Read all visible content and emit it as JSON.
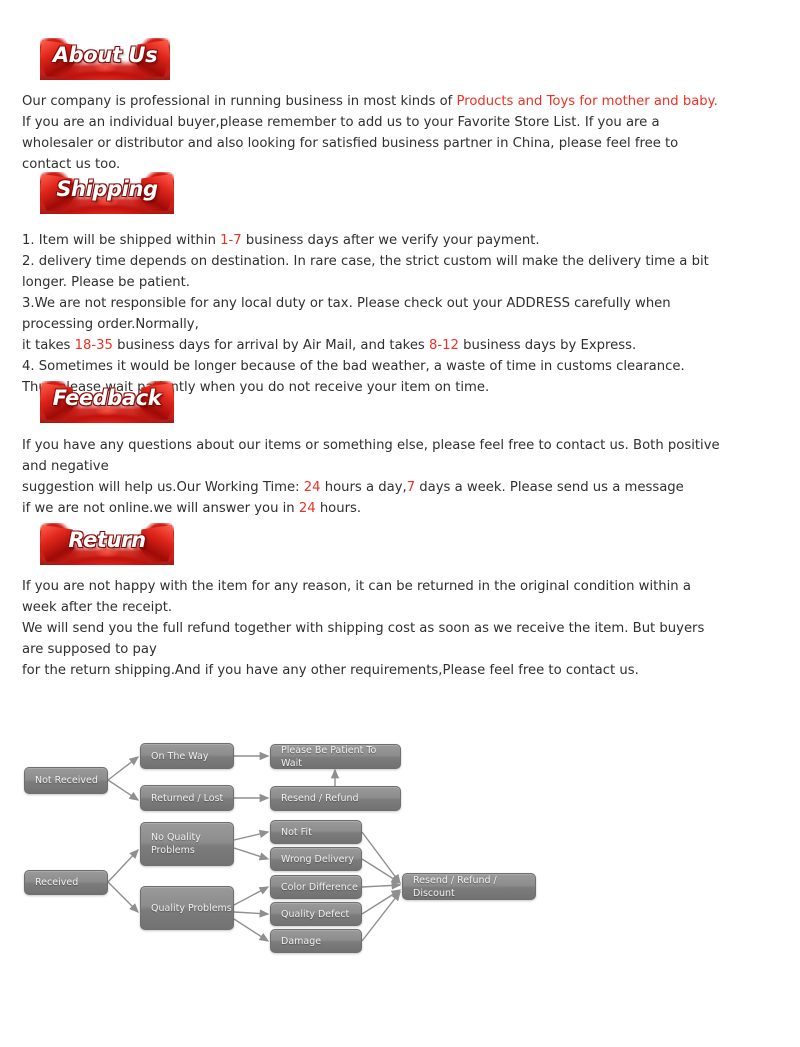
{
  "page": {
    "accent_red": "#ee3124",
    "banner_red": "#cf1a12",
    "box_gray": "#8d8d8d"
  },
  "sections": {
    "about": {
      "banner_label": "About Us",
      "lines": [
        "Our company is professional in running business in most kinds of ",
        "Products and Toys for mother and baby.",
        " If you are an individual buyer,please remember to add us to your Favorite Store List. If you are a  wholesaler or distributor and also looking for satisfied business partner in China, please feel free to contact us too."
      ],
      "text_plain": "Our company is professional in running business in most kinds of Products and Toys for mother and baby. If you are an individual buyer,please remember to add us to your Favorite Store List. If you are a  wholesaler or distributor and also looking for satisfied business partner in China, please feel free to contact us too.",
      "highlight": "Products and Toys for mother and baby."
    },
    "shipping": {
      "banner_label": "Shipping",
      "line1_a": "1. Item will be shipped within ",
      "line1_hl": "1-7",
      "line1_b": " business days after we verify your payment.",
      "line2": "2. delivery time depends on destination. In rare case, the strict custom will  make the delivery time a bit longer. Please be patient.",
      "line3": "3.We are not responsible for any local duty or tax. Please check out your ADDRESS carefully when processing order.Normally,",
      "line4_a": "it takes ",
      "line4_hl1": "18-35",
      "line4_b": " business days for arrival by Air Mail, and takes ",
      "line4_hl2": "8-12",
      "line4_c": " business days by Express.",
      "line5": "4. Sometimes it would be longer because of the bad weather, a waste of time in customs clearance.",
      "line6": "Thus please wait patiently when you do not receive your item on time."
    },
    "feedback": {
      "banner_label": "Feedback",
      "line1": "If you have any questions about our items or something else, please feel free to contact us. Both positive and negative",
      "line2_a": "suggestion will help us.Our Working Time: ",
      "line2_hl1": "24",
      "line2_b": " hours a day,",
      "line2_hl2": "7",
      "line2_c": " days a week. Please send us a message",
      "line3_a": "if we are not online.we will answer you in ",
      "line3_hl": "24",
      "line3_b": " hours."
    },
    "return": {
      "banner_label": "Return",
      "line1": "If you are not happy with the item for any reason, it can be returned in the original condition within a week after the receipt.",
      "line2": "We will send you the full refund together with shipping cost as soon as we receive the item. But buyers are supposed to pay",
      "line3": "for the return shipping.And if you have any other requirements,Please feel free to contact us."
    }
  },
  "flowchart": {
    "nodes": {
      "not_received": "Not Received",
      "on_the_way": "On The Way",
      "returned_lost": "Returned / Lost",
      "please_be_patient": "Please Be Patient To Wait",
      "resend_refund": "Resend / Refund",
      "received": "Received",
      "no_quality_problems": "No Quality\nProblems",
      "quality_problems": "Quality Problems",
      "not_fit": "Not Fit",
      "wrong_delivery": "Wrong Delivery",
      "color_difference": "Color Difference",
      "quality_defect": "Quality Defect",
      "damage": "Damage",
      "resend_refund_discount": "Resend / Refund / Discount"
    }
  }
}
